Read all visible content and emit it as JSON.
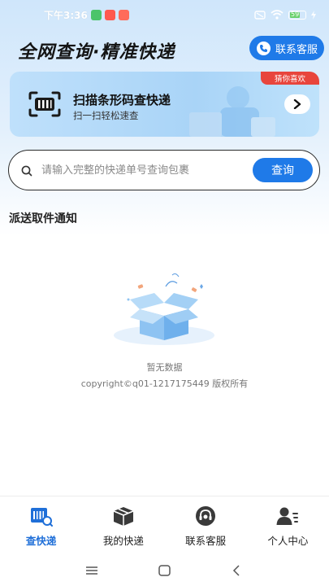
{
  "status_bar": {
    "time": "下午3:36",
    "battery": "59"
  },
  "header": {
    "title": "全网查询·精准快递",
    "customer_service": "联系客服"
  },
  "scan_banner": {
    "title": "扫描条形码查快递",
    "subtitle": "扫一扫轻松速查",
    "tag": "猜你喜欢"
  },
  "search": {
    "placeholder": "请输入完整的快递单号查询包裹",
    "value": "",
    "button_label": "查询"
  },
  "section": {
    "title": "派送取件通知"
  },
  "empty_state": {
    "text": "暂无数据",
    "copyright": "copyright©q01-1217175449 版权所有"
  },
  "tabs": [
    {
      "label": "查快递",
      "icon": "barcode-search-icon",
      "active": true
    },
    {
      "label": "我的快递",
      "icon": "package-icon",
      "active": false
    },
    {
      "label": "联系客服",
      "icon": "headset-icon",
      "active": false
    },
    {
      "label": "个人中心",
      "icon": "user-profile-icon",
      "active": false
    }
  ],
  "colors": {
    "primary": "#1f7ae8",
    "active_tab": "#1f6fd8",
    "tag_red": "#e8453c",
    "header_bg": "#cfe6fb"
  }
}
